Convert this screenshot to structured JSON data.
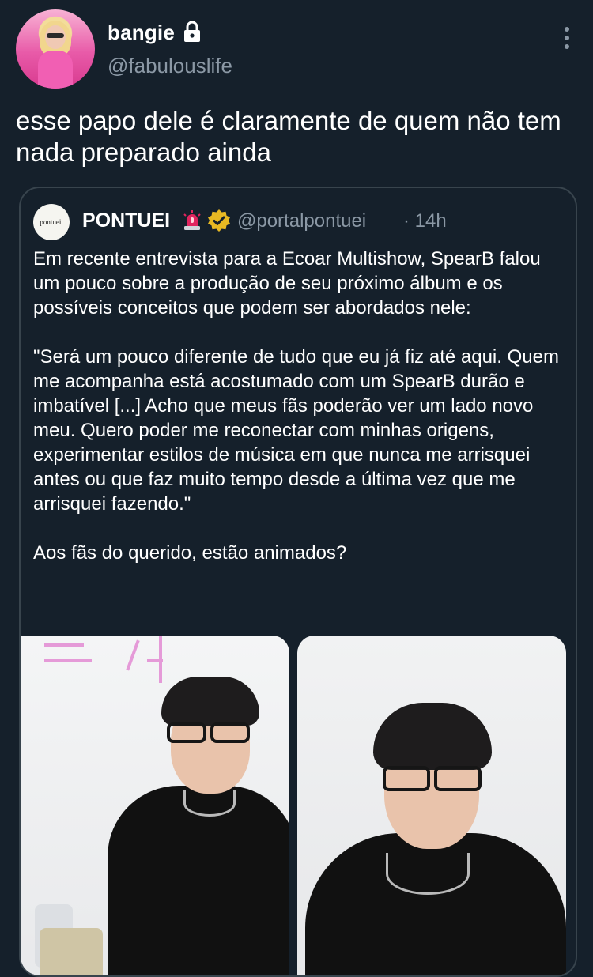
{
  "tweet": {
    "author": {
      "display_name": "bangie",
      "handle": "@fabulouslife"
    },
    "text": "esse papo dele é claramente de quem não tem nada preparado ainda"
  },
  "quoted_tweet": {
    "avatar_text": "pontuei.",
    "display_name": "PONTUEI",
    "handle": "@portalpontuei",
    "time": "· 14h",
    "body": "Em recente entrevista para a Ecoar Multishow, SpearB falou um pouco sobre a produção de seu próximo álbum e os possíveis conceitos que podem ser abordados nele:\n\n\"Será um pouco diferente de tudo que eu já fiz até aqui. Quem me acompanha está acostumado com um SpearB durão e imbatível [...] Acho que meus fãs poderão ver um lado novo meu. Quero poder me reconectar com minhas origens, experimentar estilos de música em que nunca me arrisquei antes ou que faz muito tempo desde a última vez que me arrisquei fazendo.\"\n\nAos fãs do querido, estão animados?"
  },
  "icons": {
    "lock": "lock-icon",
    "more": "more-vertical-icon",
    "siren": "siren-icon",
    "verified": "verified-badge-icon"
  },
  "colors": {
    "background": "#15202b",
    "secondary_text": "#8b98a5",
    "border": "#38444d",
    "verified_gold": "#e8b923"
  }
}
